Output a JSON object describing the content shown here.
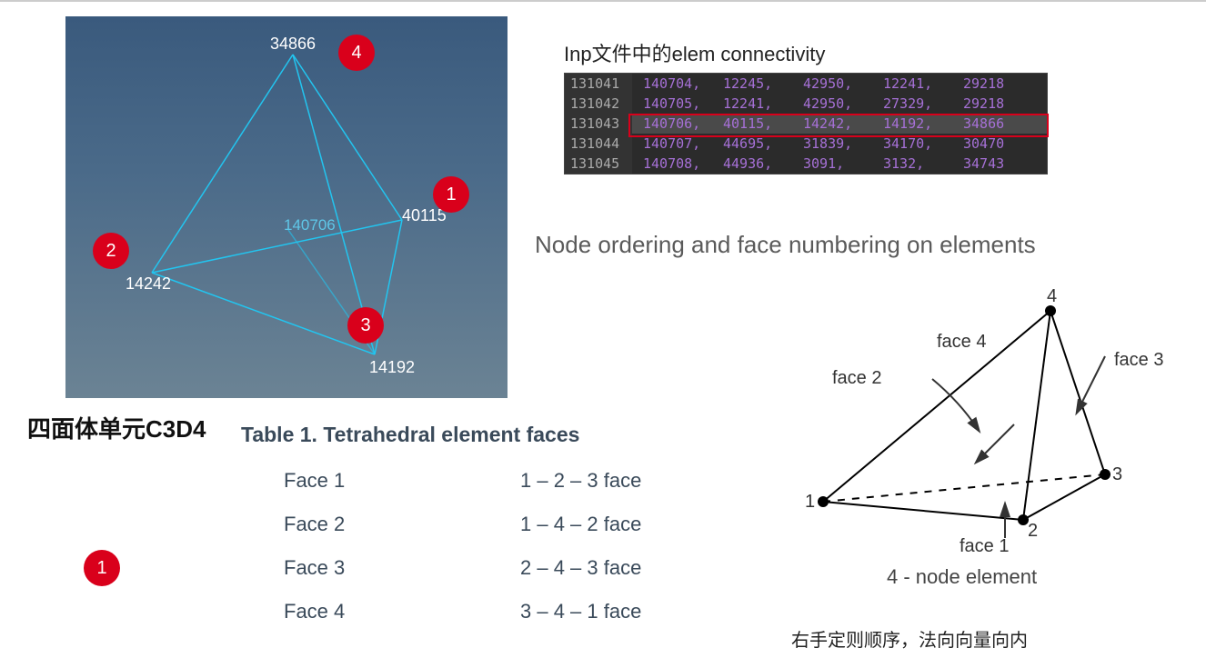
{
  "viewport": {
    "elem_id": "140706",
    "nodes": {
      "n1": "40115",
      "n2": "14242",
      "n3": "14192",
      "n4": "34866"
    },
    "badges": [
      "1",
      "2",
      "3",
      "4"
    ]
  },
  "caption_cn": "四面体单元C3D4",
  "conn_label": "Inp文件中的elem connectivity",
  "code_rows": [
    {
      "line": "131041",
      "vals": [
        "140704,",
        "12245,",
        "42950,",
        "12241,",
        "29218"
      ]
    },
    {
      "line": "131042",
      "vals": [
        "140705,",
        "12241,",
        "42950,",
        "27329,",
        "29218"
      ]
    },
    {
      "line": "131043",
      "vals": [
        "140706,",
        "40115,",
        "14242,",
        "14192,",
        "34866"
      ],
      "hl": true
    },
    {
      "line": "131044",
      "vals": [
        "140707,",
        "44695,",
        "31839,",
        "34170,",
        "30470"
      ]
    },
    {
      "line": "131045",
      "vals": [
        "140708,",
        "44936,",
        "3091,",
        "3132,",
        "34743"
      ]
    }
  ],
  "section_heading": "Node ordering and face numbering on elements",
  "table_title": "Table 1. Tetrahedral element faces",
  "faces": [
    {
      "name": "Face 1",
      "def": "1 – 2 – 3 face"
    },
    {
      "name": "Face 2",
      "def": "1 – 4 – 2 face"
    },
    {
      "name": "Face 3",
      "def": "2 – 4 – 3 face"
    },
    {
      "name": "Face 4",
      "def": "3 – 4 – 1 face"
    }
  ],
  "lone_badge": "1",
  "node_diagram": {
    "faces": [
      "face 1",
      "face 2",
      "face 3",
      "face 4"
    ],
    "nodes": [
      "1",
      "2",
      "3",
      "4"
    ],
    "caption": "4 - node element"
  },
  "rhr_note": "右手定则顺序，法向向量向内"
}
